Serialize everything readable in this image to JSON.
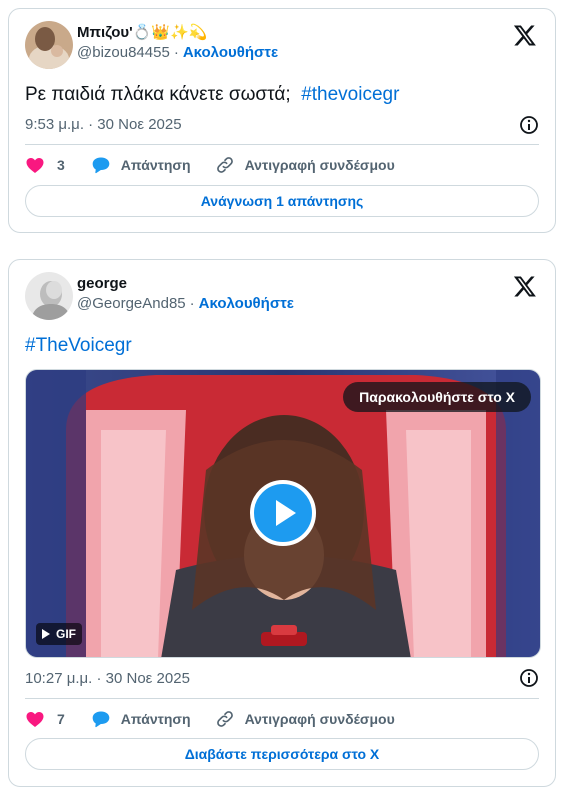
{
  "colors": {
    "accent": "#006fd6",
    "like": "#f91880",
    "reply_icon": "#1d9bf0",
    "muted": "#536471",
    "border": "#cfd9de"
  },
  "tweets": [
    {
      "display_name": "Μπιζου'💍👑✨💫",
      "handle": "@bizou84455",
      "separator": "·",
      "follow_label": "Ακολουθήστε",
      "text": "Ρε παιδιά πλάκα κάνετε σωστά;",
      "hashtag": "#thevoicegr",
      "timestamp": "9:53 μ.μ. · 30 Νοε 2025",
      "likes": "3",
      "reply_label": "Απάντηση",
      "copy_label": "Αντιγραφή συνδέσμου",
      "bottom_button": "Ανάγνωση 1 απάντησης"
    },
    {
      "display_name": "george",
      "handle": "@GeorgeAnd85",
      "separator": "·",
      "follow_label": "Ακολουθήστε",
      "hashtag": "#TheVoicegr",
      "watch_label": "Παρακολουθήστε στο X",
      "gif_label": "GIF",
      "timestamp": "10:27 μ.μ. · 30 Νοε 2025",
      "likes": "7",
      "reply_label": "Απάντηση",
      "copy_label": "Αντιγραφή συνδέσμου",
      "bottom_button": "Διαβάστε περισσότερα στο X"
    }
  ]
}
